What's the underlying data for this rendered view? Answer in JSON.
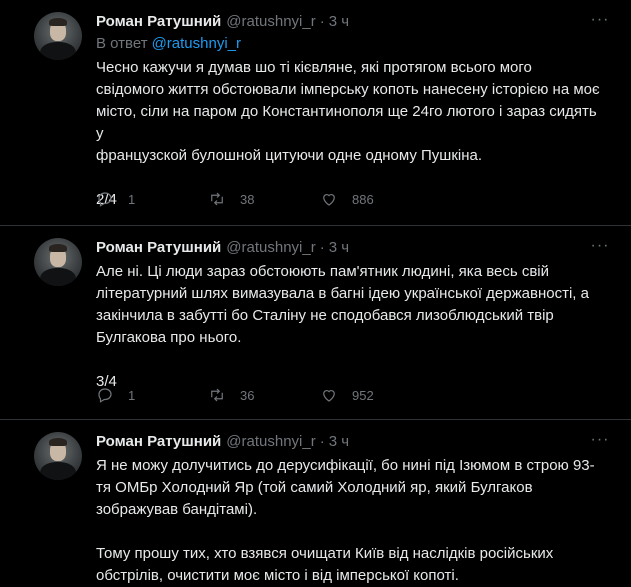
{
  "colors": {
    "background": "#000000",
    "text": "#e7e9ea",
    "muted": "#71767b",
    "link": "#1d9bf0",
    "divider": "#2f3336"
  },
  "tweets": [
    {
      "author": "Роман Ратушний",
      "handle": "@ratushnyi_r",
      "separator": "·",
      "time": "3 ч",
      "reply_prefix": "В ответ",
      "reply_to": "@ratushnyi_r",
      "text": "Чесно кажучи я думав шо ті кієвляне, які протягом всього мого\nсвідомого життя обстоювали імперську копоть нанесену історією на моє\nмісто, сіли на паром до Константинополя ще 24го лютого і зараз сидять у\nфранцузской булошной цитуючи одне одному Пушкіна.\n\n2/4",
      "stats": {
        "replies": "1",
        "retweets": "38",
        "likes": "886"
      }
    },
    {
      "author": "Роман Ратушний",
      "handle": "@ratushnyi_r",
      "separator": "·",
      "time": "3 ч",
      "text": "Але ні. Ці люди зараз обстоюють пам'ятник людині, яка весь свій\nлітературний шлях вимазувала в багні ідею української державності, а\nзакінчила в забутті бо Сталіну не сподобався лизоблюдський твір\nБулгакова про нього.\n\n3/4",
      "stats": {
        "replies": "1",
        "retweets": "36",
        "likes": "952"
      }
    },
    {
      "author": "Роман Ратушний",
      "handle": "@ratushnyi_r",
      "separator": "·",
      "time": "3 ч",
      "text": "Я не можу долучитись до дерусифікації, бо нині під Ізюмом в строю 93-\nтя ОМБр Холодний Яр (той самий Холодний яр, який Булгаков\nзображував бандітамі).\n\nТому прошу тих, хто взявся очищати Київ від наслідків російських\nобстрілів, очистити моє місто і від імперської копоті."
    }
  ],
  "icons": {
    "more": "more-horizontal-icon",
    "reply": "reply-bubble-icon",
    "retweet": "retweet-icon",
    "like": "heart-icon"
  }
}
